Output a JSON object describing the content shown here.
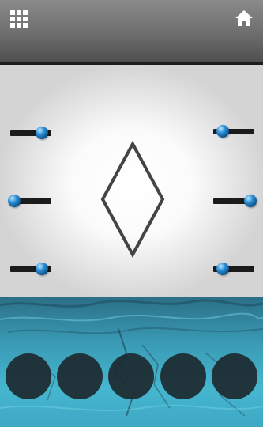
{
  "header": {
    "menu_icon": "grid-menu-icon",
    "home_icon": "home-icon"
  },
  "puzzle": {
    "shape": "diamond-outline",
    "sliders": [
      {
        "name": "left-top",
        "side": "left",
        "knob_position": "right"
      },
      {
        "name": "left-middle",
        "side": "left",
        "knob_position": "left"
      },
      {
        "name": "left-bottom",
        "side": "left",
        "knob_position": "right"
      },
      {
        "name": "right-top",
        "side": "right",
        "knob_position": "left"
      },
      {
        "name": "right-middle",
        "side": "right",
        "knob_position": "right"
      },
      {
        "name": "right-bottom",
        "side": "right",
        "knob_position": "left"
      }
    ]
  },
  "inventory": {
    "slot_count": 5,
    "slots": [
      "empty",
      "empty",
      "empty",
      "empty",
      "empty"
    ]
  },
  "colors": {
    "knob": "#2b8fd6",
    "track": "#1b1b1b",
    "water": "#3a9ab5",
    "slot": "#1d2a30"
  }
}
